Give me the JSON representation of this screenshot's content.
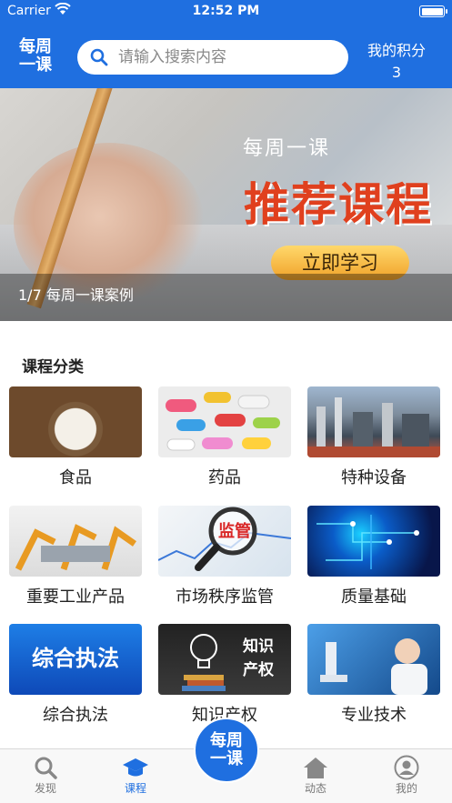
{
  "status": {
    "carrier": "Carrier",
    "time": "12:52 PM"
  },
  "header": {
    "logo_line1": "每周",
    "logo_line2": "一课",
    "search_placeholder": "请输入搜索内容",
    "points_label": "我的积分",
    "points_value": "3"
  },
  "banner": {
    "subtitle": "每周一课",
    "title": "推荐课程",
    "cta": "立即学习",
    "caption": "1/7 每周一课案例"
  },
  "categories": {
    "title": "课程分类",
    "items": [
      {
        "label": "食品",
        "icon": "food-image"
      },
      {
        "label": "药品",
        "icon": "drug-image"
      },
      {
        "label": "特种设备",
        "icon": "special-equipment-image"
      },
      {
        "label": "重要工业产品",
        "icon": "industrial-products-image"
      },
      {
        "label": "市场秩序监管",
        "icon": "market-supervision-image",
        "image_text": "监管"
      },
      {
        "label": "质量基础",
        "icon": "quality-foundation-image"
      },
      {
        "label": "综合执法",
        "icon": "law-enforcement-image",
        "image_text": "综合执法"
      },
      {
        "label": "知识产权",
        "icon": "intellectual-property-image",
        "image_text_1": "知识",
        "image_text_2": "产权"
      },
      {
        "label": "专业技术",
        "icon": "professional-tech-image"
      }
    ]
  },
  "tabbar": {
    "items": [
      {
        "label": "发现",
        "icon": "search-icon"
      },
      {
        "label": "课程",
        "icon": "graduation-cap-icon",
        "active": true
      },
      {
        "label": "动态",
        "icon": "home-icon"
      },
      {
        "label": "我的",
        "icon": "user-icon"
      }
    ],
    "center_line1": "每周",
    "center_line2": "一课"
  },
  "colors": {
    "primary": "#1f6fe0",
    "banner_title": "#e0401e"
  }
}
